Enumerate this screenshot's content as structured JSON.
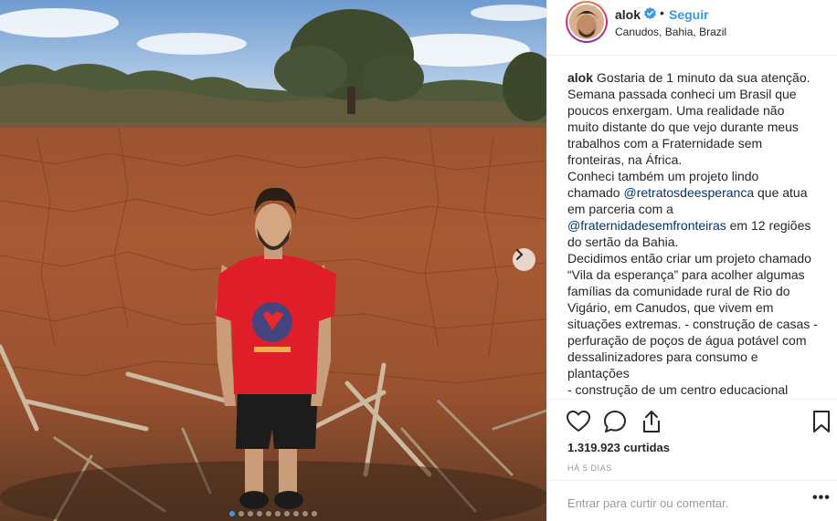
{
  "post": {
    "username": "alok",
    "follow_label": "Seguir",
    "separator": "•",
    "location": "Canudos, Bahia, Brazil",
    "caption_lines": [
      "Gostaria de 1 minuto da sua atenção.",
      "Semana passada conheci um Brasil que",
      "poucos enxergam. Uma realidade não",
      "muito distante do que vejo durante meus",
      "trabalhos com a Fraternidade sem",
      "fronteiras, na África.",
      "Conheci também um projeto lindo",
      "chamado",
      "@retratosdeesperanca",
      "que atua",
      "em parceria com a",
      "@fraternidadesemfronteiras",
      "em 12 regiões",
      "do sertão da Bahia.",
      "Decidimos então criar um projeto chamado",
      "“Vila da esperança” para acolher algumas",
      "famílias da comunidade rural de Rio do",
      "Vigário, em Canudos, que vivem em",
      "situações extremas. - construção de casas -",
      "perfuração de poços de água potável com",
      "dessalinizadores para consumo e",
      "plantações",
      "- construção de um centro educacional"
    ],
    "likes": "1.319.923 curtidas",
    "time_ago": "HÁ 5 DIAS",
    "comment_placeholder": "Entrar para curtir ou comentar.",
    "more_label": "•••"
  },
  "carousel": {
    "total": 10,
    "current_index": 0
  },
  "icons": {
    "verified": "verified-badge-icon",
    "like": "heart-icon",
    "comment": "comment-bubble-icon",
    "share": "share-icon",
    "save": "bookmark-icon",
    "next": "chevron-right-icon",
    "more": "more-options-icon"
  },
  "colors": {
    "accent": "#3897f0",
    "mention": "#003569",
    "text": "#262626",
    "muted": "#999999",
    "divider": "#efefef"
  }
}
